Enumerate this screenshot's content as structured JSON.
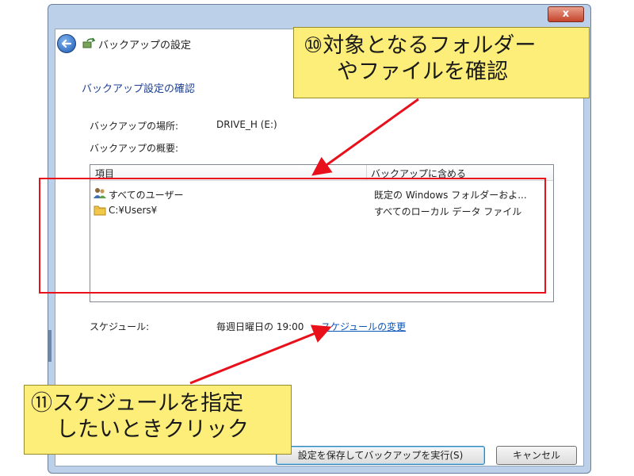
{
  "window": {
    "close_glyph": "x"
  },
  "nav": {
    "title": "バックアップの設定"
  },
  "page": {
    "heading": "バックアップ設定の確認",
    "location_label": "バックアップの場所:",
    "location_value": "DRIVE_H (E:)",
    "summary_label": "バックアップの概要:"
  },
  "summary_table": {
    "columns": [
      "項目",
      "バックアップに含める"
    ],
    "rows": [
      {
        "item": "すべてのユーザー",
        "includes": "既定の Windows フォルダーおよ...",
        "icon": "users-icon"
      },
      {
        "item": "C:¥Users¥",
        "includes": "すべてのローカル データ ファイル",
        "icon": "folder-icon"
      }
    ]
  },
  "schedule": {
    "label": "スケジュール:",
    "value": "毎週日曜日の 19:00",
    "change_link": "スケジュールの変更"
  },
  "buttons": {
    "save_and_run": "設定を保存してバックアップを実行(S)",
    "cancel": "キャンセル"
  },
  "callouts": {
    "top": [
      "⑩対象となるフォルダー",
      "やファイルを確認"
    ],
    "bottom": [
      "⑪スケジュールを指定",
      "したいときクリック"
    ]
  },
  "colors": {
    "accent_red": "#e8101a",
    "callout_yellow": "#fdee7a",
    "link_blue": "#0a55b8"
  }
}
